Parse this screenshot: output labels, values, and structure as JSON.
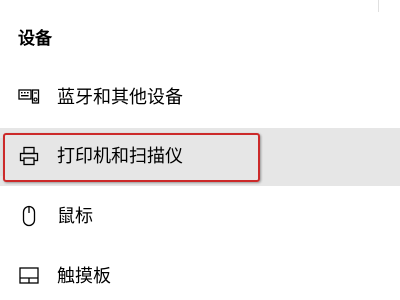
{
  "section": {
    "title": "设备"
  },
  "nav": {
    "items": [
      {
        "label": "蓝牙和其他设备",
        "icon": "bluetooth-devices-icon",
        "selected": false
      },
      {
        "label": "打印机和扫描仪",
        "icon": "printer-icon",
        "selected": true
      },
      {
        "label": "鼠标",
        "icon": "mouse-icon",
        "selected": false
      },
      {
        "label": "触摸板",
        "icon": "touchpad-icon",
        "selected": false
      }
    ]
  },
  "colors": {
    "selected_background": "#e6e6e6",
    "highlight_border": "#cc2a2a",
    "text": "#000000"
  }
}
